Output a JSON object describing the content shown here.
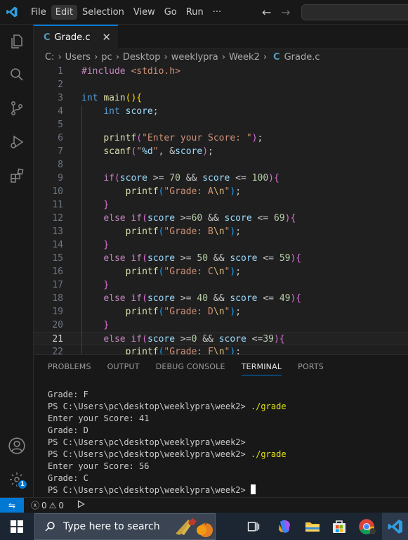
{
  "menu": [
    "File",
    "Edit",
    "Selection",
    "View",
    "Go",
    "Run",
    "···"
  ],
  "tab": {
    "icon": "C",
    "label": "Grade.c"
  },
  "breadcrumbs": [
    "C:",
    "Users",
    "pc",
    "Desktop",
    "weeklypra",
    "Week2"
  ],
  "breadcrumb_file": {
    "icon": "C",
    "label": "Grade.c"
  },
  "code_lines": [
    {
      "n": "1",
      "html": "<span style=\"color:#c586c0\">#include</span> <span style=\"color:#ce9178\">&lt;stdio.h&gt;</span>"
    },
    {
      "n": "2",
      "html": ""
    },
    {
      "n": "3",
      "html": "<span style=\"color:#569cd6\">int</span> <span style=\"color:#dcdcaa\">main</span><span style=\"color:#ffd700\">()</span><span style=\"color:#ffd700\">{</span>"
    },
    {
      "n": "4",
      "html": "    <span style=\"color:#569cd6\">int</span> <span style=\"color:#9cdcfe\">score</span>;"
    },
    {
      "n": "5",
      "html": ""
    },
    {
      "n": "6",
      "html": "    <span style=\"color:#dcdcaa\">printf</span><span style=\"color:#da70d6\">(</span><span style=\"color:#ce9178\">\"Enter your Score: \"</span><span style=\"color:#da70d6\">)</span>;"
    },
    {
      "n": "7",
      "html": "    <span style=\"color:#dcdcaa\">scanf</span><span style=\"color:#da70d6\">(</span><span style=\"color:#ce9178\">\"</span><span style=\"color:#9cdcfe\">%d</span><span style=\"color:#ce9178\">\"</span>, &amp;<span style=\"color:#9cdcfe\">score</span><span style=\"color:#da70d6\">)</span>;"
    },
    {
      "n": "8",
      "html": ""
    },
    {
      "n": "9",
      "html": "    <span style=\"color:#c586c0\">if</span><span style=\"color:#da70d6\">(</span><span style=\"color:#9cdcfe\">score</span> &gt;= <span style=\"color:#b5cea8\">70</span> &amp;&amp; <span style=\"color:#9cdcfe\">score</span> &lt;= <span style=\"color:#b5cea8\">100</span><span style=\"color:#da70d6\">)</span><span style=\"color:#da70d6\">{</span>"
    },
    {
      "n": "10",
      "html": "        <span style=\"color:#dcdcaa\">printf</span><span style=\"color:#179fff\">(</span><span style=\"color:#ce9178\">\"Grade: A</span><span style=\"color:#d7ba7d\">\\n</span><span style=\"color:#ce9178\">\"</span><span style=\"color:#179fff\">)</span>;"
    },
    {
      "n": "11",
      "html": "    <span style=\"color:#da70d6\">}</span>"
    },
    {
      "n": "12",
      "html": "    <span style=\"color:#c586c0\">else</span> <span style=\"color:#c586c0\">if</span><span style=\"color:#da70d6\">(</span><span style=\"color:#9cdcfe\">score</span> &gt;=<span style=\"color:#b5cea8\">60</span> &amp;&amp; <span style=\"color:#9cdcfe\">score</span> &lt;= <span style=\"color:#b5cea8\">69</span><span style=\"color:#da70d6\">)</span><span style=\"color:#da70d6\">{</span>"
    },
    {
      "n": "13",
      "html": "        <span style=\"color:#dcdcaa\">printf</span><span style=\"color:#179fff\">(</span><span style=\"color:#ce9178\">\"Grade: B</span><span style=\"color:#d7ba7d\">\\n</span><span style=\"color:#ce9178\">\"</span><span style=\"color:#179fff\">)</span>;"
    },
    {
      "n": "14",
      "html": "    <span style=\"color:#da70d6\">}</span>"
    },
    {
      "n": "15",
      "html": "    <span style=\"color:#c586c0\">else</span> <span style=\"color:#c586c0\">if</span><span style=\"color:#da70d6\">(</span><span style=\"color:#9cdcfe\">score</span> &gt;= <span style=\"color:#b5cea8\">50</span> &amp;&amp; <span style=\"color:#9cdcfe\">score</span> &lt;= <span style=\"color:#b5cea8\">59</span><span style=\"color:#da70d6\">)</span><span style=\"color:#da70d6\">{</span>"
    },
    {
      "n": "16",
      "html": "        <span style=\"color:#dcdcaa\">printf</span><span style=\"color:#179fff\">(</span><span style=\"color:#ce9178\">\"Grade: C</span><span style=\"color:#d7ba7d\">\\n</span><span style=\"color:#ce9178\">\"</span><span style=\"color:#179fff\">)</span>;"
    },
    {
      "n": "17",
      "html": "    <span style=\"color:#da70d6\">}</span>"
    },
    {
      "n": "18",
      "html": "    <span style=\"color:#c586c0\">else</span> <span style=\"color:#c586c0\">if</span><span style=\"color:#da70d6\">(</span><span style=\"color:#9cdcfe\">score</span> &gt;= <span style=\"color:#b5cea8\">40</span> &amp;&amp; <span style=\"color:#9cdcfe\">score</span> &lt;= <span style=\"color:#b5cea8\">49</span><span style=\"color:#da70d6\">)</span><span style=\"color:#da70d6\">{</span>"
    },
    {
      "n": "19",
      "html": "        <span style=\"color:#dcdcaa\">printf</span><span style=\"color:#179fff\">(</span><span style=\"color:#ce9178\">\"Grade: D</span><span style=\"color:#d7ba7d\">\\n</span><span style=\"color:#ce9178\">\"</span><span style=\"color:#179fff\">)</span>;"
    },
    {
      "n": "20",
      "html": "    <span style=\"color:#da70d6\">}</span>"
    },
    {
      "n": "21",
      "html": "    <span style=\"color:#c586c0\">else</span> <span style=\"color:#c586c0\">if</span><span style=\"color:#da70d6\">(</span><span style=\"color:#9cdcfe\">score</span> &gt;=<span style=\"color:#b5cea8\">0</span> &amp;&amp; <span style=\"color:#9cdcfe\">score</span> &lt;=<span style=\"color:#b5cea8\">39</span><span style=\"color:#da70d6\">)</span><span style=\"color:#da70d6\">{</span>"
    },
    {
      "n": "22",
      "html": "        <span style=\"color:#dcdcaa\">printf</span><span style=\"color:#179fff\">(</span><span style=\"color:#ce9178\">\"Grade: F</span><span style=\"color:#d7ba7d\">\\n</span><span style=\"color:#ce9178\">\"</span><span style=\"color:#179fff\">)</span>;"
    }
  ],
  "current_line": "21",
  "panel_tabs": [
    "PROBLEMS",
    "OUTPUT",
    "DEBUG CONSOLE",
    "TERMINAL",
    "PORTS"
  ],
  "active_panel_tab": "TERMINAL",
  "terminal_lines": [
    {
      "text": "Grade: F",
      "cmd": ""
    },
    {
      "text": "PS C:\\Users\\pc\\desktop\\weeklypra\\week2> ",
      "cmd": "./grade"
    },
    {
      "text": "Enter your Score: 41",
      "cmd": ""
    },
    {
      "text": "Grade: D",
      "cmd": ""
    },
    {
      "text": "PS C:\\Users\\pc\\desktop\\weeklypra\\week2>",
      "cmd": ""
    },
    {
      "text": "PS C:\\Users\\pc\\desktop\\weeklypra\\week2> ",
      "cmd": "./grade"
    },
    {
      "text": "Enter your Score: 56",
      "cmd": ""
    },
    {
      "text": "Grade: C",
      "cmd": ""
    },
    {
      "text": "PS C:\\Users\\pc\\desktop\\weeklypra\\week2> ",
      "cmd": "",
      "cursor": true
    }
  ],
  "status": {
    "errors": "0",
    "warnings": "0"
  },
  "activity_badge": "1",
  "taskbar": {
    "search_placeholder": "Type here to search"
  },
  "colors": {
    "accent": "#0078d4",
    "editor_bg": "#1f1f1f",
    "chrome_bg": "#181818",
    "taskbar_bg": "#1c2633"
  }
}
